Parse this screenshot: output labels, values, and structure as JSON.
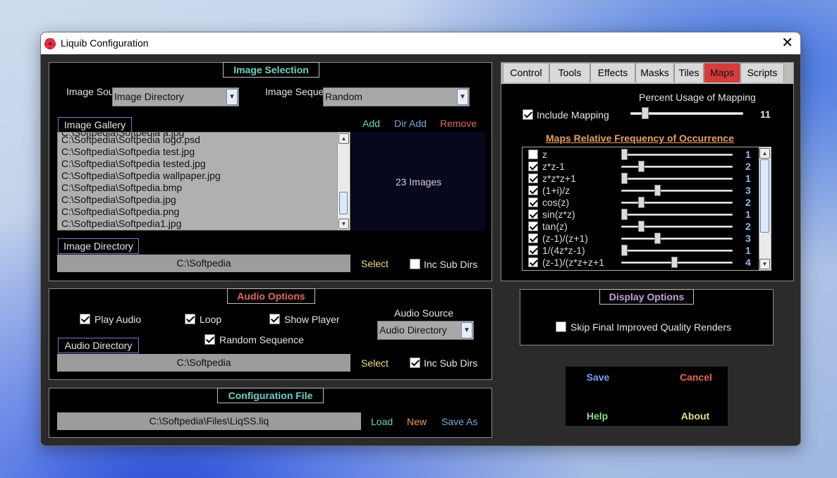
{
  "window": {
    "title": "Liquib Configuration"
  },
  "image_selection": {
    "title": "Image Selection",
    "source_label": "Image Source",
    "source_value": "Image Directory",
    "sequence_label": "Image Sequence",
    "sequence_value": "Random",
    "gallery_label": "Image Gallery",
    "add": "Add",
    "dir_add": "Dir Add",
    "remove": "Remove",
    "gallery_items": [
      "C:\\Softpedia\\Softpedia logo.psd",
      "C:\\Softpedia\\Softpedia test.jpg",
      "C:\\Softpedia\\Softpedia tested.jpg",
      "C:\\Softpedia\\Softpedia wallpaper.jpg",
      "C:\\Softpedia\\Softpedia.bmp",
      "C:\\Softpedia\\Softpedia.jpg",
      "C:\\Softpedia\\Softpedia.png",
      "C:\\Softpedia\\Softpedia1.jpg"
    ],
    "image_count": "23 Images",
    "directory_label": "Image Directory",
    "directory_value": "C:\\Softpedia",
    "select": "Select",
    "inc_sub_dirs": "Inc Sub Dirs"
  },
  "audio_options": {
    "title": "Audio Options",
    "play_audio": "Play Audio",
    "loop": "Loop",
    "show_player": "Show Player",
    "random_sequence": "Random Sequence",
    "source_label": "Audio Source",
    "source_value": "Audio Directory",
    "directory_label": "Audio Directory",
    "directory_value": "C:\\Softpedia",
    "select": "Select",
    "inc_sub_dirs": "Inc Sub Dirs"
  },
  "config_file": {
    "title": "Configuration File",
    "path": "C:\\Softpedia\\Files\\LiqSS.liq",
    "load": "Load",
    "new": "New",
    "save_as": "Save As"
  },
  "tabs": [
    "Control",
    "Tools",
    "Effects",
    "Masks",
    "Tiles",
    "Maps",
    "Scripts"
  ],
  "active_tab": "Maps",
  "maps": {
    "percent_label": "Percent Usage of Mapping",
    "include_mapping": "Include Mapping",
    "percent_value": "11",
    "percent_fraction": 0.1,
    "freq_title": "Maps Relative Frequency of Occurrence",
    "items": [
      {
        "name": "z",
        "checked": false,
        "value": "1",
        "level": 0.0
      },
      {
        "name": "z*z-1",
        "checked": true,
        "value": "2",
        "level": 0.15
      },
      {
        "name": "z*z*z+1",
        "checked": true,
        "value": "1",
        "level": 0.0
      },
      {
        "name": "(1+i)/z",
        "checked": true,
        "value": "3",
        "level": 0.3
      },
      {
        "name": "cos(z)",
        "checked": true,
        "value": "2",
        "level": 0.15
      },
      {
        "name": "sin(z*z)",
        "checked": true,
        "value": "1",
        "level": 0.0
      },
      {
        "name": "tan(z)",
        "checked": true,
        "value": "2",
        "level": 0.15
      },
      {
        "name": "(z-1)/(z+1)",
        "checked": true,
        "value": "3",
        "level": 0.3
      },
      {
        "name": "1/(4z*z-1)",
        "checked": true,
        "value": "1",
        "level": 0.0
      },
      {
        "name": "(z-1)/(z*z+z+1",
        "checked": true,
        "value": "4",
        "level": 0.45
      }
    ]
  },
  "display_options": {
    "title": "Display Options",
    "skip_final": "Skip Final Improved Quality Renders"
  },
  "buttons": {
    "save": "Save",
    "cancel": "Cancel",
    "help": "Help",
    "about": "About"
  },
  "colors": {
    "teal": "#6fd1c4",
    "blue": "#79a8d8",
    "red": "#e06a5a",
    "yellow": "#e8e08a",
    "orange": "#e8a060",
    "maps_tab": "#d63c3c"
  }
}
